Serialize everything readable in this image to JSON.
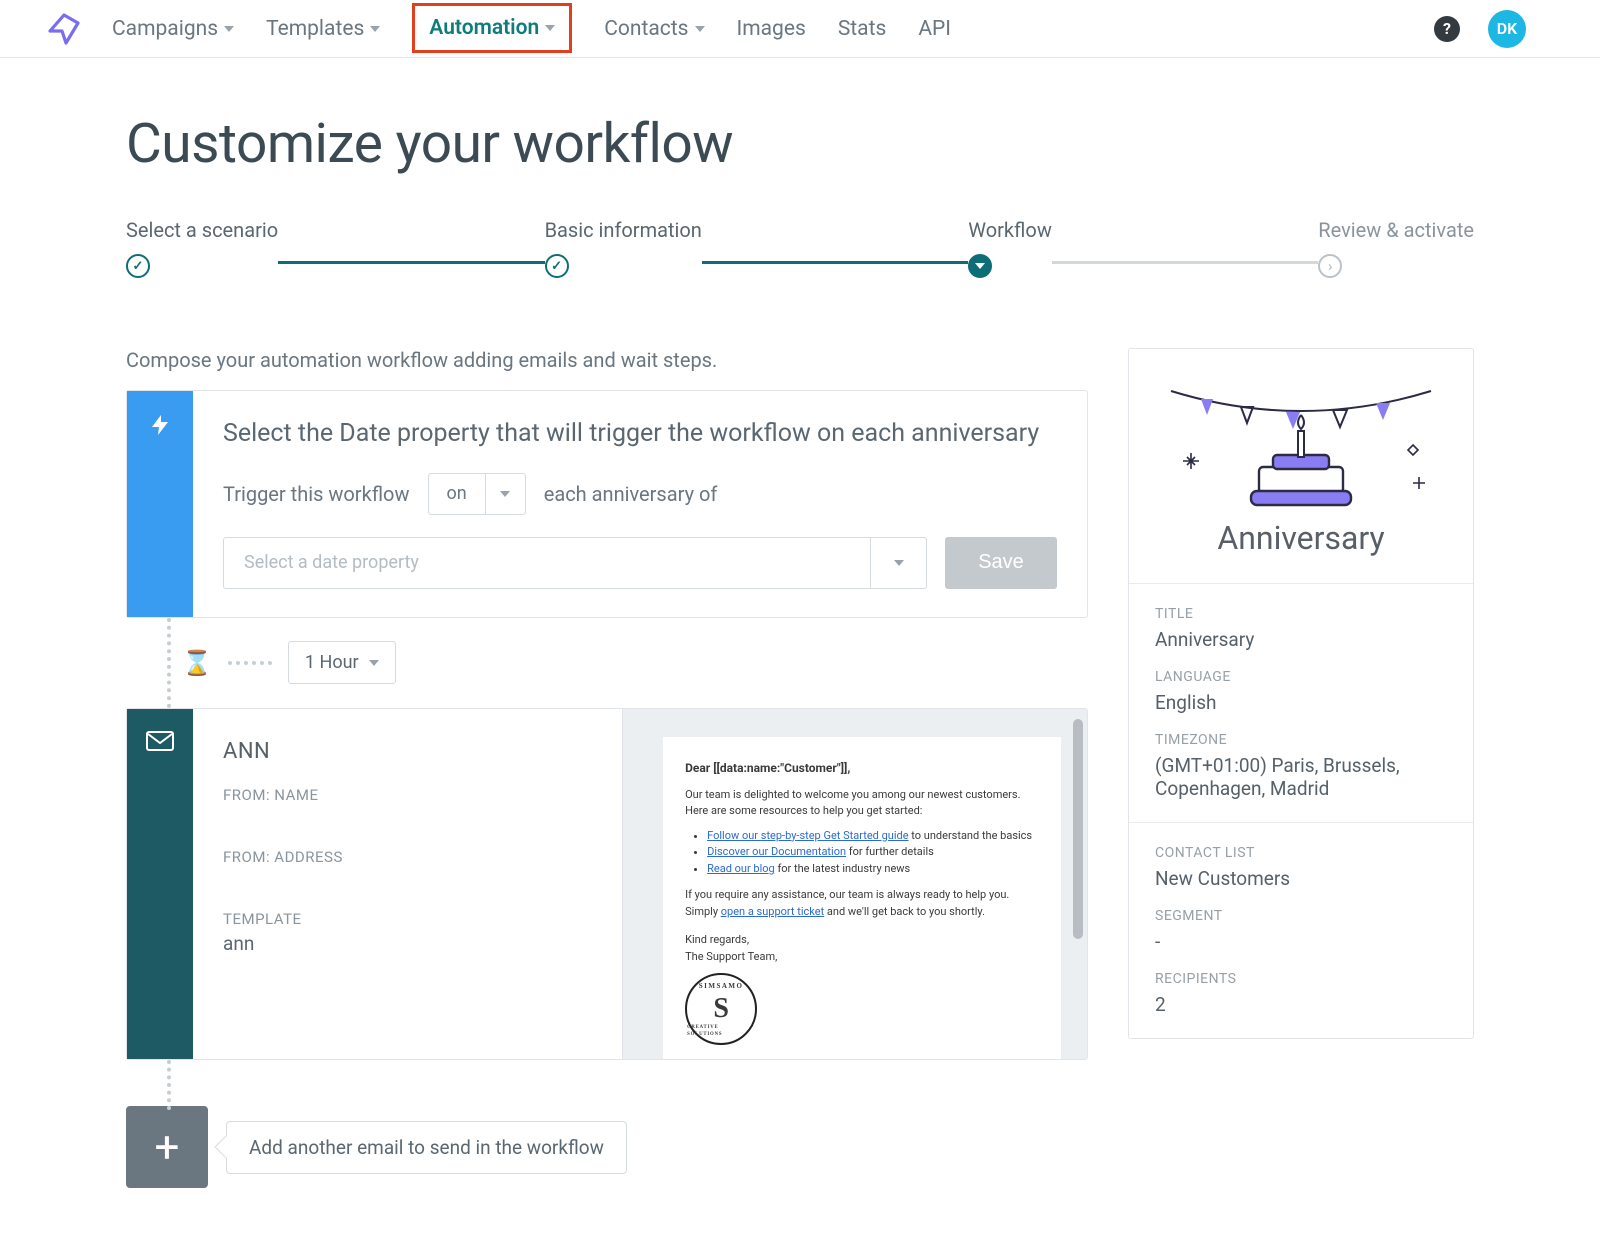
{
  "nav": {
    "items": [
      {
        "label": "Campaigns",
        "dropdown": true
      },
      {
        "label": "Templates",
        "dropdown": true
      },
      {
        "label": "Automation",
        "dropdown": true,
        "active": true
      },
      {
        "label": "Contacts",
        "dropdown": true
      },
      {
        "label": "Images",
        "dropdown": false
      },
      {
        "label": "Stats",
        "dropdown": false
      },
      {
        "label": "API",
        "dropdown": false
      }
    ],
    "avatar_initials": "DK"
  },
  "page": {
    "title": "Customize your workflow",
    "instructions": "Compose your automation workflow adding emails and wait steps."
  },
  "stepper": {
    "steps": [
      {
        "label": "Select a scenario",
        "state": "completed"
      },
      {
        "label": "Basic information",
        "state": "completed"
      },
      {
        "label": "Workflow",
        "state": "current"
      },
      {
        "label": "Review & activate",
        "state": "pending"
      }
    ]
  },
  "trigger": {
    "heading": "Select the Date property that will trigger the workflow on each anniversary",
    "prefix": "Trigger this workflow",
    "on_value": "on",
    "suffix": "each anniversary of",
    "date_property_placeholder": "Select a date property",
    "save_label": "Save"
  },
  "wait": {
    "value": "1 Hour"
  },
  "email": {
    "name": "ANN",
    "labels": {
      "from_name": "FROM: NAME",
      "from_address": "FROM: ADDRESS",
      "template": "TEMPLATE"
    },
    "from_name": "",
    "from_address": "",
    "template": "ann",
    "preview": {
      "greeting": "Dear [[data:name:\"Customer\"]],",
      "line1": "Our team is delighted to welcome you among our newest customers.",
      "line2": "Here are some resources to help you get started:",
      "bullets": [
        {
          "link": "Follow our step-by-step Get Started guide",
          "tail": " to understand the basics"
        },
        {
          "link": "Discover our Documentation",
          "tail": " for further details"
        },
        {
          "link": "Read our blog",
          "tail": " for the latest industry news"
        }
      ],
      "support_pre": "If you require any assistance, our team is always ready to help you. Simply ",
      "support_link": "open a support ticket",
      "support_post": " and we'll get back to you shortly.",
      "closing": "Kind regards,",
      "signature": "The Support Team,"
    }
  },
  "add": {
    "label": "Add another email to send in the workflow"
  },
  "sidebar": {
    "title": "Anniversary",
    "labels": {
      "title": "TITLE",
      "language": "LANGUAGE",
      "timezone": "TIMEZONE",
      "contact_list": "CONTACT LIST",
      "segment": "SEGMENT",
      "recipients": "RECIPIENTS"
    },
    "values": {
      "title": "Anniversary",
      "language": "English",
      "timezone": "(GMT+01:00) Paris, Brussels, Copenhagen, Madrid",
      "contact_list": "New Customers",
      "segment": "-",
      "recipients": "2"
    }
  },
  "colors": {
    "accent_teal": "#0e6e77",
    "trigger_blue": "#3a9cf0",
    "email_rail": "#1d5a63",
    "highlight_box": "#e33e1e",
    "avatar": "#1cb7e3"
  }
}
